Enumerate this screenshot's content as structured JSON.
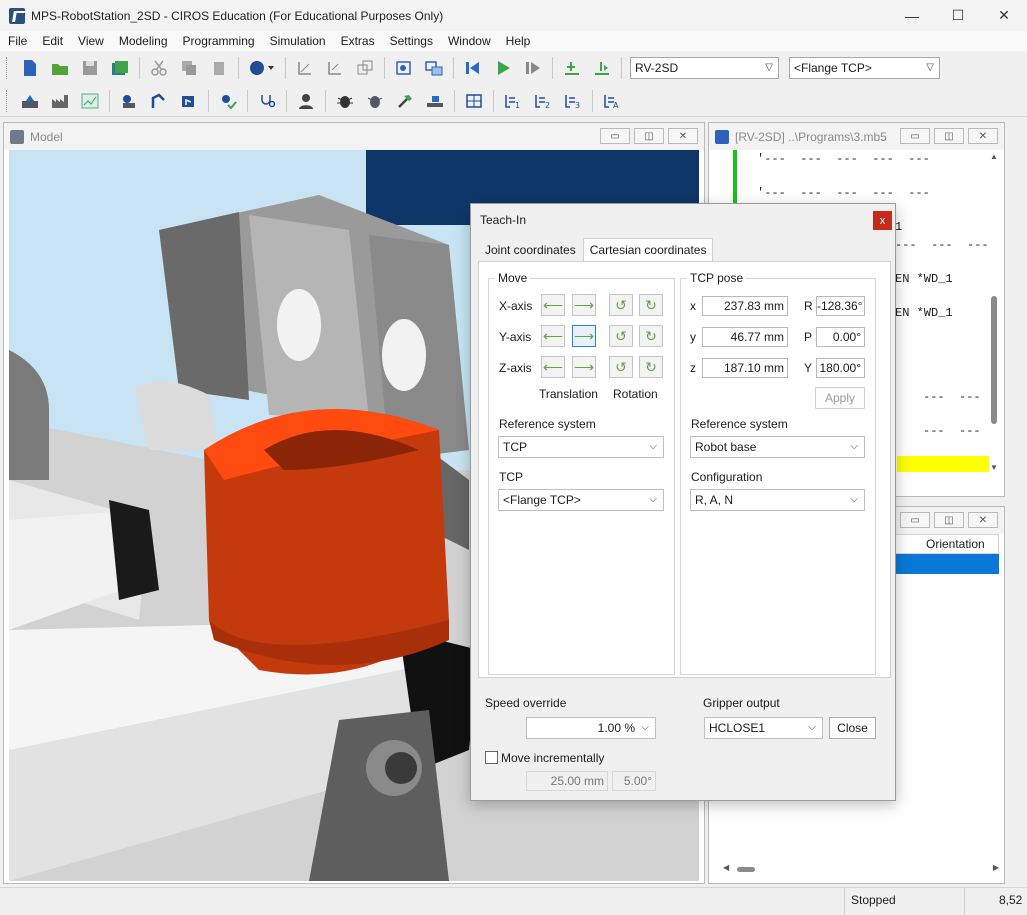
{
  "window": {
    "title": "MPS-RobotStation_2SD - CIROS Education (For Educational Purposes Only)",
    "minimize": "—",
    "maximize": "☐",
    "close": "✕"
  },
  "menu": [
    "File",
    "Edit",
    "View",
    "Modeling",
    "Programming",
    "Simulation",
    "Extras",
    "Settings",
    "Window",
    "Help"
  ],
  "toolbar": {
    "robot_select": "RV-2SD",
    "tcp_select": "<Flange TCP>"
  },
  "model_window": {
    "title": "Model"
  },
  "program_window": {
    "title": "[RV-2SD] ..\\Programs\\3.mb5",
    "lines": [
      "'---  ---  ---  ---  ---",
      "'---  ---  ---  ---  ---",
      "1",
      "---  ---  ---",
      "EN *WD_1",
      "EN *WD_1",
      "---  ---",
      "---  ---"
    ]
  },
  "position_window": {
    "column_header": "Orientation"
  },
  "statusbar": {
    "state": "Stopped",
    "version": "8,52"
  },
  "teachin": {
    "title": "Teach-In",
    "close": "x",
    "tabs": [
      "Joint coordinates",
      "Cartesian coordinates"
    ],
    "active_tab": "Cartesian coordinates",
    "move": {
      "title": "Move",
      "x_axis": "X-axis",
      "y_axis": "Y-axis",
      "z_axis": "Z-axis",
      "translation": "Translation",
      "rotation": "Rotation",
      "reference_label": "Reference system",
      "reference_value": "TCP",
      "tcp_label": "TCP",
      "tcp_value": "<Flange TCP>"
    },
    "pose": {
      "title": "TCP pose",
      "x_label": "x",
      "x_value": "237.83 mm",
      "y_label": "y",
      "y_value": "46.77 mm",
      "z_label": "z",
      "z_value": "187.10 mm",
      "r_label": "R",
      "r_value": "-128.36°",
      "p_label": "P",
      "p_value": "0.00°",
      "yaw_label": "Y",
      "yaw_value": "180.00°",
      "apply": "Apply",
      "reference_label": "Reference system",
      "reference_value": "Robot base",
      "config_label": "Configuration",
      "config_value": "R, A, N"
    },
    "speed_label": "Speed override",
    "speed_value": "1.00 %",
    "gripper_label": "Gripper output",
    "gripper_value": "HCLOSE1",
    "close_button": "Close",
    "incremental_label": "Move incrementally",
    "inc_distance": "25.00 mm",
    "inc_angle": "5.00°"
  }
}
